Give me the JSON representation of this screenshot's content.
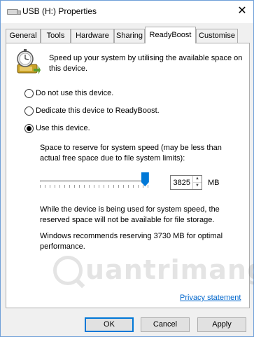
{
  "window": {
    "title": "USB (H:) Properties",
    "close_glyph": "✕"
  },
  "tabs": [
    {
      "label": "General"
    },
    {
      "label": "Tools"
    },
    {
      "label": "Hardware"
    },
    {
      "label": "Sharing"
    },
    {
      "label": "ReadyBoost",
      "active": true
    },
    {
      "label": "Customise"
    }
  ],
  "readyboost": {
    "icon": "readyboost-stopwatch-icon",
    "intro": "Speed up your system by utilising the available space on this device.",
    "options": [
      {
        "label": "Do not use this device.",
        "checked": false
      },
      {
        "label": "Dedicate this device to ReadyBoost.",
        "checked": false
      },
      {
        "label": "Use this device.",
        "checked": true
      }
    ],
    "reserve_label": "Space to reserve for system speed (may be less than actual free space due to file system limits):",
    "slider_fraction": 0.97,
    "reserve_value": "3825",
    "reserve_unit": "MB",
    "note": "While the device is being used for system speed, the reserved space will not be available for file storage.",
    "recommendation": "Windows recommends reserving 3730 MB for optimal performance.",
    "privacy_link": "Privacy statement"
  },
  "watermark": {
    "text": "uantrimang"
  },
  "buttons": {
    "ok": "OK",
    "cancel": "Cancel",
    "apply": "Apply"
  },
  "colors": {
    "accent": "#0078d7",
    "link": "#0066cc",
    "window_border": "#6f9fd8"
  }
}
